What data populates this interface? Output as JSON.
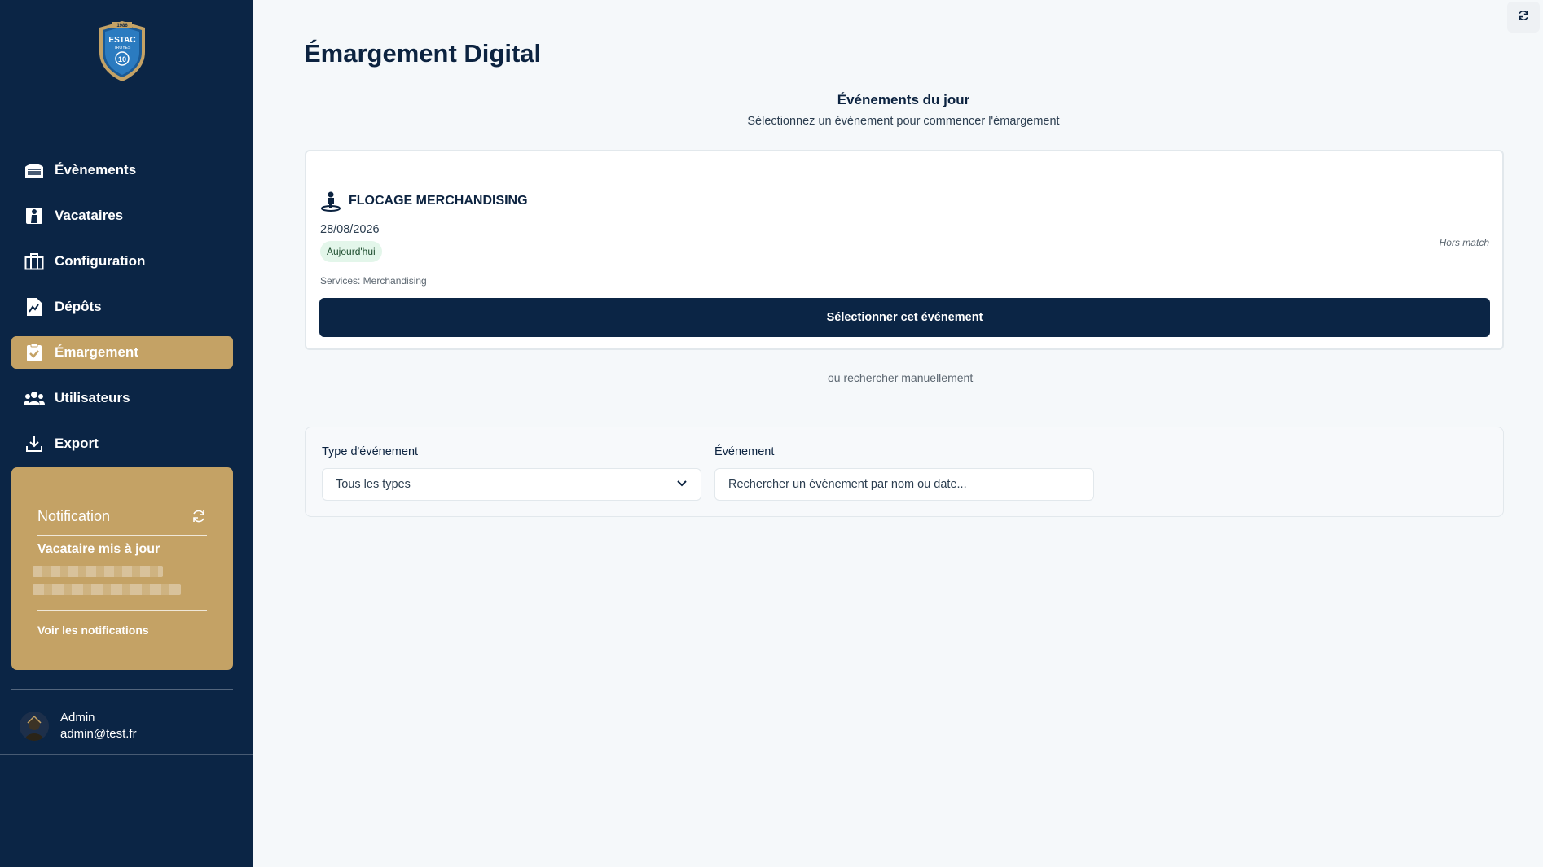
{
  "app": {
    "logo": {
      "year": "1986",
      "name": "ESTAC",
      "city": "TROYES",
      "number": "10"
    }
  },
  "sidebar": {
    "items": [
      {
        "label": "Évènements",
        "icon": "stadium-icon"
      },
      {
        "label": "Vacataires",
        "icon": "person-badge-icon"
      },
      {
        "label": "Configuration",
        "icon": "building-icon"
      },
      {
        "label": "Dépôts",
        "icon": "document-chart-icon"
      },
      {
        "label": "Émargement",
        "icon": "clipboard-check-icon",
        "active": true
      },
      {
        "label": "Utilisateurs",
        "icon": "users-icon"
      },
      {
        "label": "Export",
        "icon": "download-icon"
      }
    ],
    "notification": {
      "title": "Notification",
      "message": "Vacataire mis à jour",
      "link": "Voir les notifications"
    },
    "user": {
      "name": "Admin",
      "email": "admin@test.fr"
    }
  },
  "main": {
    "title": "Émargement Digital",
    "section_title": "Événements du jour",
    "section_subtitle": "Sélectionnez un événement pour commencer l'émargement",
    "event": {
      "name": "FLOCAGE MERCHANDISING",
      "date": "28/08/2026",
      "badge": "Aujourd'hui",
      "type": "Hors match",
      "services": "Services: Merchandising",
      "button": "Sélectionner cet événement"
    },
    "divider_label": "ou rechercher manuellement",
    "search": {
      "type_label": "Type d'événement",
      "type_value": "Tous les types",
      "event_label": "Événement",
      "event_placeholder": "Rechercher un événement par nom ou date..."
    }
  },
  "colors": {
    "sidebar_bg": "#0b2545",
    "accent": "#c4a265",
    "page_bg": "#f5f8fa",
    "badge_bg": "#e3f6ea"
  }
}
